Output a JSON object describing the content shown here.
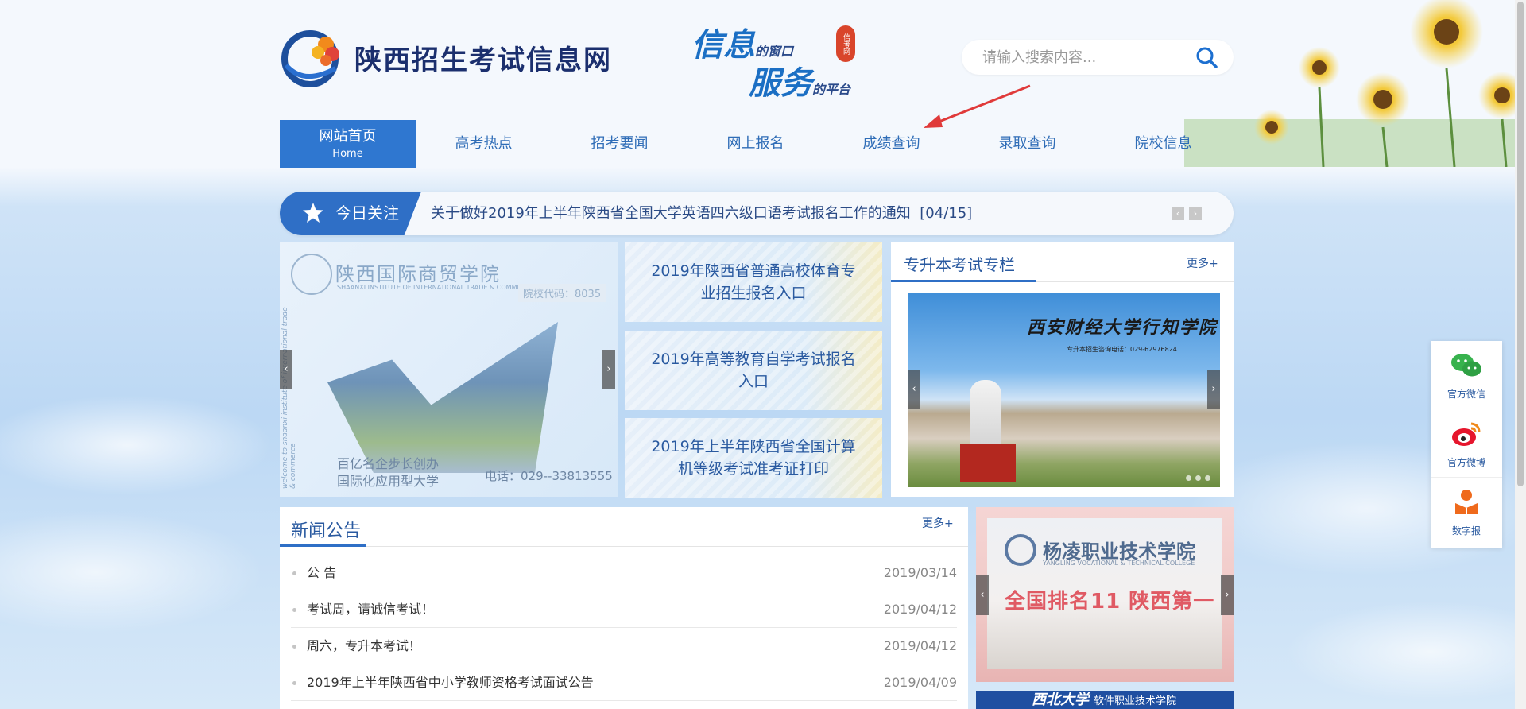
{
  "header": {
    "site_title": "陕西招生考试信息网",
    "slogan_line1_big": "信息",
    "slogan_line1_small": "的窗口",
    "slogan_line2_big": "服务",
    "slogan_line2_small": "的平台",
    "slogan_seal": "信考网",
    "search_placeholder": "请输入搜索内容..."
  },
  "nav": {
    "items": [
      {
        "label": "网站首页",
        "sub": "Home",
        "active": true
      },
      {
        "label": "高考热点"
      },
      {
        "label": "招考要闻"
      },
      {
        "label": "网上报名"
      },
      {
        "label": "成绩查询"
      },
      {
        "label": "录取查询"
      },
      {
        "label": "院校信息"
      }
    ]
  },
  "notice": {
    "tag": "今日关注",
    "text": "关于做好2019年上半年陕西省全国大学英语四六级口语考试报名工作的通知",
    "date": "[04/15]",
    "prev": "‹",
    "next": "›"
  },
  "banner": {
    "title": "陕西国际商贸学院",
    "subtitle": "SHAANXI INSTITUTE OF INTERNATIONAL TRADE & COMMERCE",
    "code": "院校代码：8035",
    "vertical": "welcome to shaanxi institute of international trade & commerce",
    "slogan_line1": "百亿名企步长创办",
    "slogan_line2": "国际化应用型大学",
    "phone": "电话：029--33813555"
  },
  "cards": [
    {
      "label": "2019年陕西省普通高校体育专业招生报名入口"
    },
    {
      "label": "2019年高等教育自学考试报名入口"
    },
    {
      "label": "2019年上半年陕西省全国计算机等级考试准考证打印"
    }
  ],
  "zsb": {
    "title": "专升本考试专栏",
    "more": "更多+",
    "image_caption": "西安财经大学行知学院",
    "image_tel": "专升本招生咨询电话：029-62976824"
  },
  "news": {
    "title": "新闻公告",
    "more": "更多+",
    "items": [
      {
        "title": "公 告",
        "date": "2019/03/14"
      },
      {
        "title": "考试周，请诚信考试！",
        "date": "2019/04/12"
      },
      {
        "title": "周六，专升本考试！",
        "date": "2019/04/12"
      },
      {
        "title": "2019年上半年陕西省中小学教师资格考试面试公告",
        "date": "2019/04/09"
      }
    ]
  },
  "ad": {
    "name": "杨凌职业技术学院",
    "en": "YANGLING VOCATIONAL & TECHNICAL COLLEGE",
    "slogan": "全国排名11  陕西第一"
  },
  "ad2": {
    "name": "西北大学",
    "sub": "软件职业技术学院"
  },
  "float": {
    "wechat": "官方微信",
    "weibo": "官方微博",
    "paper": "数字报"
  },
  "colors": {
    "accent": "#2f6fc6",
    "link": "#2a5aa0",
    "arrow": "#e03a3a"
  }
}
